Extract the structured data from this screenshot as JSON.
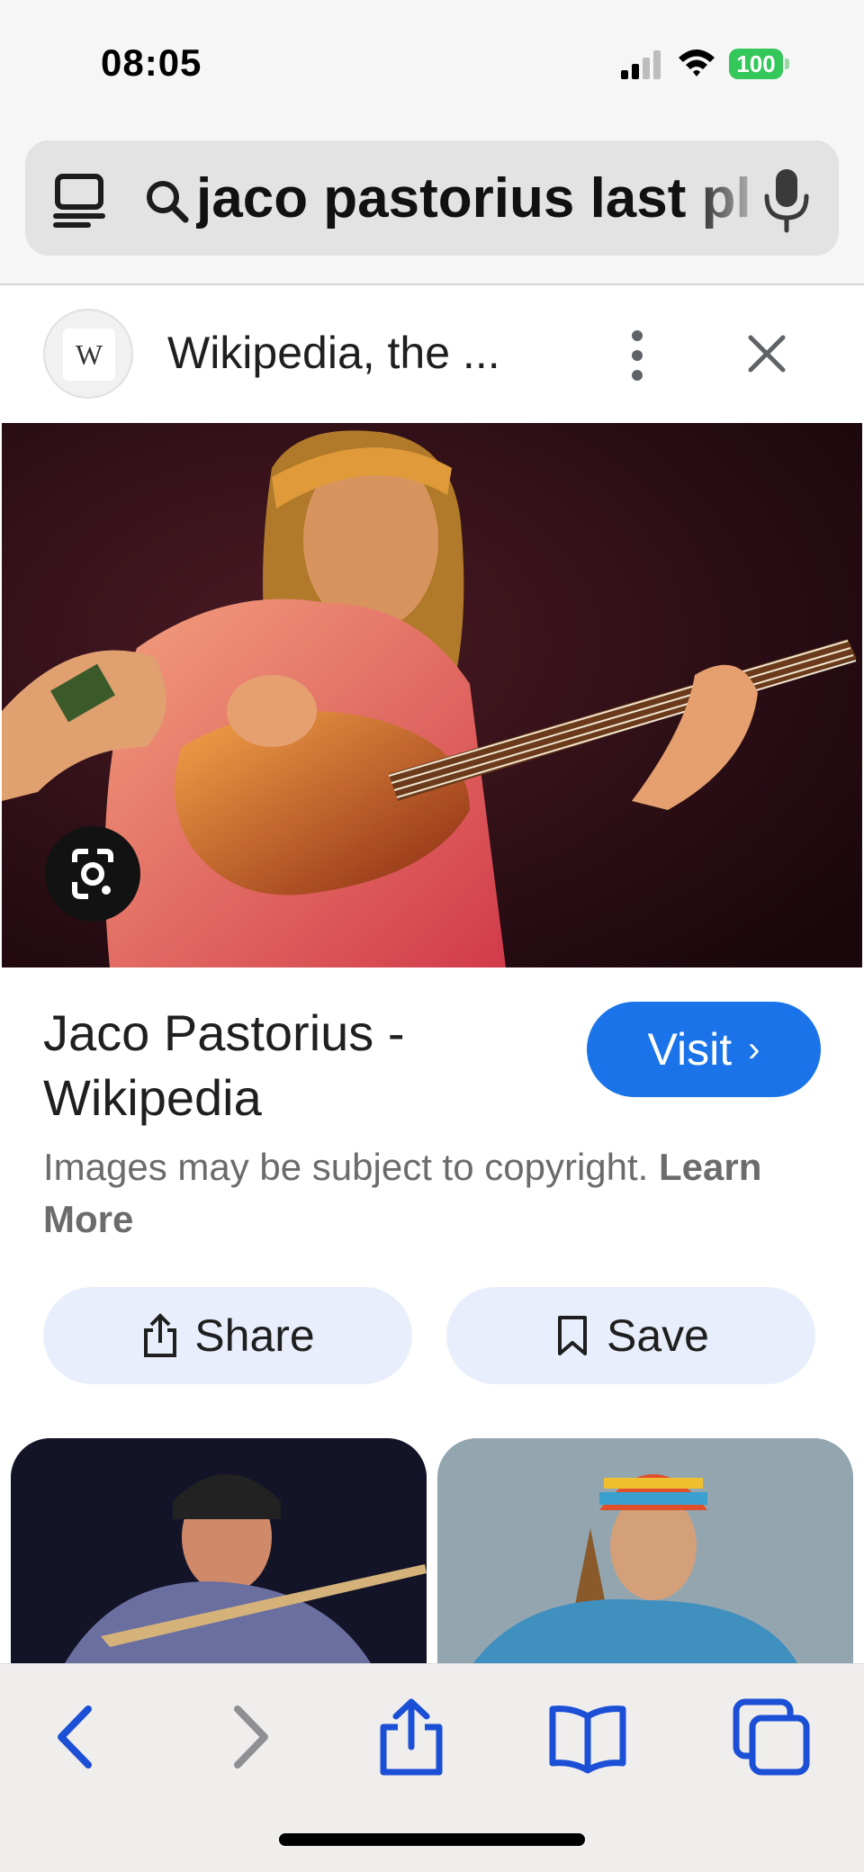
{
  "status_bar": {
    "time": "08:05",
    "battery": "100",
    "battery_color": "#34c759"
  },
  "address_bar": {
    "query": "jaco pastorius last pl",
    "icons": [
      "tab-overview-icon",
      "search-icon",
      "microphone-icon"
    ]
  },
  "source": {
    "title": "Wikipedia, the ...",
    "favicon_letter": "W",
    "icons": [
      "more-options-icon",
      "close-icon"
    ]
  },
  "result": {
    "title": "Jaco Pastorius - Wikipedia",
    "visit_label": "Visit",
    "visit_chevron": "›",
    "copyright_text": "Images may be subject to copyright.",
    "learn_more_label": "Learn More",
    "accent_color": "#1a73e8"
  },
  "actions": {
    "share_label": "Share",
    "save_label": "Save"
  },
  "toolbar": {
    "items": [
      "back-icon",
      "forward-icon",
      "share-icon",
      "bookmarks-icon",
      "tabs-icon"
    ],
    "active_color": "#1a4fd6",
    "disabled_color": "#8e8e93"
  }
}
